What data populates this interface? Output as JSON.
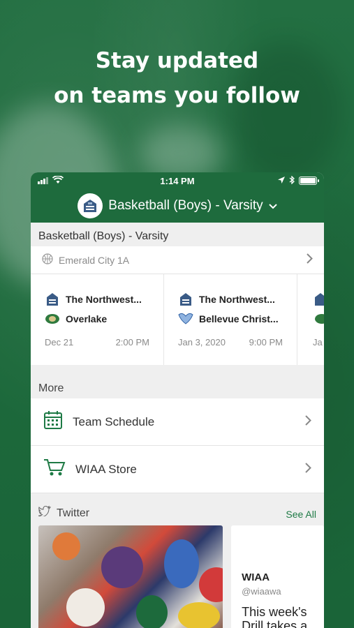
{
  "headline": {
    "line1": "Stay updated",
    "line2": "on teams you follow"
  },
  "status_bar": {
    "time": "1:14 PM"
  },
  "nav": {
    "title": "Basketball (Boys) - Varsity",
    "chevron": "⌄"
  },
  "team_section": {
    "label": "Basketball (Boys) - Varsity",
    "league": "Emerald City 1A",
    "games": [
      {
        "home_team": "The Northwest...",
        "away_team": "Overlake",
        "date": "Dec 21",
        "time": "2:00 PM"
      },
      {
        "home_team": "The Northwest...",
        "away_team": "Bellevue Christ...",
        "date": "Jan 3, 2020",
        "time": "9:00 PM"
      },
      {
        "date": "Ja"
      }
    ]
  },
  "more_section": {
    "label": "More",
    "items": [
      {
        "label": "Team Schedule",
        "icon": "calendar-icon"
      },
      {
        "label": "WIAA Store",
        "icon": "cart-icon"
      }
    ]
  },
  "twitter_section": {
    "label": "Twitter",
    "see_all": "See All",
    "tweet": {
      "name": "WIAA",
      "handle": "@wiaawa",
      "text_line1": "This week's",
      "text_line2": "Drill takes a"
    }
  },
  "colors": {
    "brand_green": "#1e6b3d",
    "link_green": "#1e7a45"
  }
}
